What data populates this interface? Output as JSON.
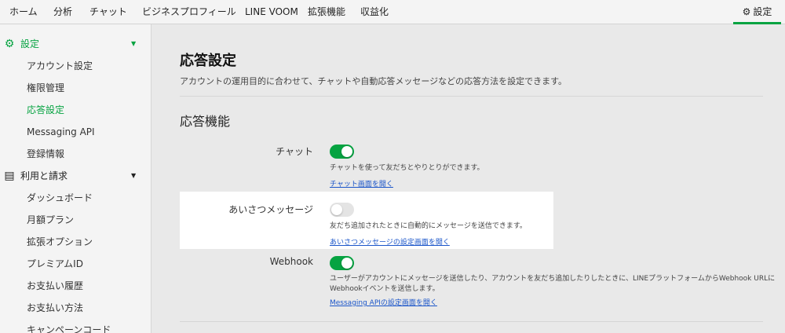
{
  "topnav": {
    "items": [
      "ホーム",
      "分析",
      "チャット",
      "ビジネスプロフィール",
      "LINE VOOM",
      "拡張機能",
      "収益化"
    ],
    "settings_label": "設定"
  },
  "sidebar": {
    "settings_group": "設定",
    "settings_items": [
      "アカウント設定",
      "権限管理",
      "応答設定",
      "Messaging API",
      "登録情報"
    ],
    "billing_group": "利用と請求",
    "billing_items": [
      "ダッシュボード",
      "月額プラン",
      "拡張オプション",
      "プレミアムID",
      "お支払い履歴",
      "お支払い方法",
      "キャンペーンコード"
    ]
  },
  "main": {
    "title": "応答設定",
    "description": "アカウントの運用目的に合わせて、チャットや自動応答メッセージなどの応答方法を設定できます。",
    "section_title": "応答機能",
    "rows": [
      {
        "label": "チャット",
        "enabled": true,
        "description": "チャットを使って友だちとやりとりができます。",
        "link": "チャット画面を開く"
      },
      {
        "label": "あいさつメッセージ",
        "enabled": false,
        "description": "友だち追加されたときに自動的にメッセージを送信できます。",
        "link": "あいさつメッセージの設定画面を開く"
      },
      {
        "label": "Webhook",
        "enabled": true,
        "description_line1": "ユーザーがアカウントにメッセージを送信したり、アカウントを友だち追加したりしたときに、LINEプラットフォームからWebhook URLに",
        "description_line2": "Webhookイベントを送信します。",
        "link": "Messaging APIの設定画面を開く"
      }
    ]
  },
  "colors": {
    "accent": "#06a341",
    "link": "#1a55c9",
    "highlight_bg": "#ffffff",
    "page_bg": "#e9e9e9"
  }
}
